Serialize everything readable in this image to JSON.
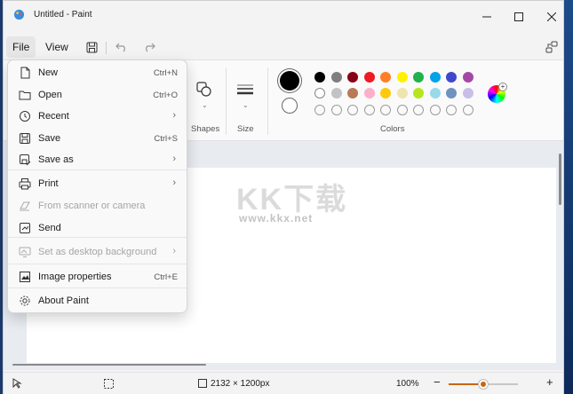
{
  "window": {
    "title": "Untitled - Paint"
  },
  "menubar": {
    "file": "File",
    "view": "View"
  },
  "ribbon": {
    "shapes_label": "Shapes",
    "size_label": "Size",
    "colors_label": "Colors"
  },
  "palette": {
    "row1": [
      "#000000",
      "#7f7f7f",
      "#880015",
      "#ed1c24",
      "#ff7f27",
      "#fff200",
      "#22b14c",
      "#00a2e8",
      "#3f48cc",
      "#a349a4"
    ],
    "row2": [
      "#ffffff",
      "#c3c3c3",
      "#b97a57",
      "#ffaec9",
      "#ffc90e",
      "#efe4b0",
      "#b5e61d",
      "#99d9ea",
      "#7092be",
      "#c8bfe7"
    ]
  },
  "watermark": {
    "text": "KK下载",
    "url": "www.kkx.net"
  },
  "file_menu": {
    "items": [
      {
        "label": "New",
        "shortcut": "Ctrl+N",
        "icon": "new-file-icon"
      },
      {
        "label": "Open",
        "shortcut": "Ctrl+O",
        "icon": "folder-icon"
      },
      {
        "label": "Recent",
        "arrow": "›",
        "icon": "clock-icon"
      },
      {
        "label": "Save",
        "shortcut": "Ctrl+S",
        "icon": "save-icon"
      },
      {
        "label": "Save as",
        "arrow": "›",
        "icon": "save-as-icon"
      },
      {
        "label": "Print",
        "arrow": "›",
        "icon": "printer-icon"
      },
      {
        "label": "From scanner or camera",
        "icon": "scanner-icon"
      },
      {
        "label": "Send",
        "icon": "send-icon"
      },
      {
        "label": "Set as desktop background",
        "arrow": "›",
        "icon": "desktop-icon"
      },
      {
        "label": "Image properties",
        "shortcut": "Ctrl+E",
        "icon": "image-properties-icon"
      },
      {
        "label": "About Paint",
        "icon": "gear-icon"
      }
    ]
  },
  "status": {
    "dimensions": "2132 × 1200px",
    "zoom": "100%",
    "zoom_level": 0.5
  }
}
